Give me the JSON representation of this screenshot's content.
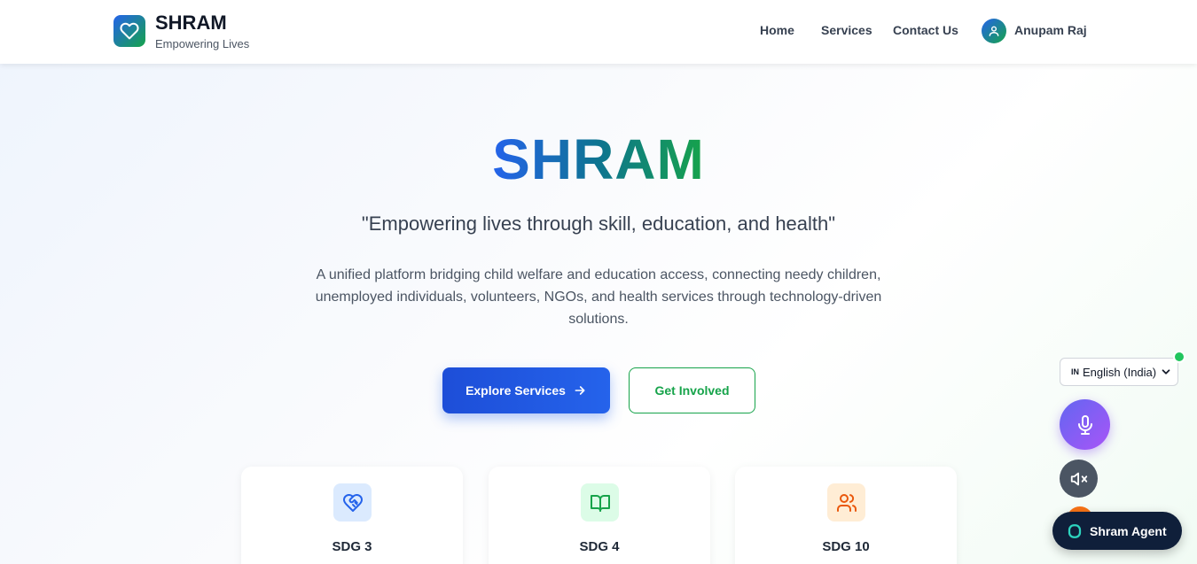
{
  "header": {
    "brand": "SHRAM",
    "tagline": "Empowering Lives",
    "nav": [
      "Home",
      "Services",
      "Contact Us"
    ],
    "user": "Anupam Raj"
  },
  "hero": {
    "title": "SHRAM",
    "tagline": "\"Empowering lives through skill, education, and health\"",
    "description": "A unified platform bridging child welfare and education access, connecting needy children, unemployed individuals, volunteers, NGOs, and health services through technology-driven solutions.",
    "primary_button": "Explore Services",
    "secondary_button": "Get Involved"
  },
  "cards": [
    {
      "title": "SDG 3",
      "icon": "heart-handshake-icon",
      "color": "#2563eb",
      "bg": "#dbeafe"
    },
    {
      "title": "SDG 4",
      "icon": "open-book-icon",
      "color": "#16a34a",
      "bg": "#dcfce7"
    },
    {
      "title": "SDG 10",
      "icon": "users-icon",
      "color": "#ea580c",
      "bg": "#ffedd5"
    }
  ],
  "assistant": {
    "language_code": "IN",
    "language": "English (India)",
    "agent_label": "Shram Agent"
  },
  "colors": {
    "primary": "#2563eb",
    "secondary": "#16a34a",
    "agent_bg": "#0f1f3a",
    "mic_gradient": [
      "#6366f1",
      "#a855f7"
    ]
  }
}
